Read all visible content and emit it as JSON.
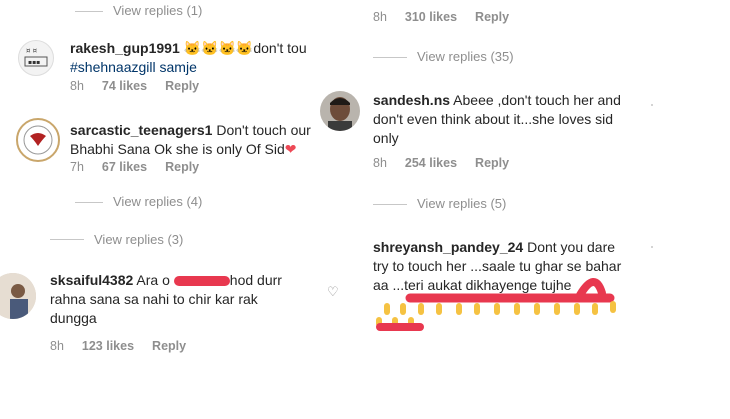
{
  "left_column": {
    "top_view_replies": "View replies (1)",
    "comments": [
      {
        "username": "rakesh_gup1991",
        "text_after_emoji": "don't tou",
        "emoji_icons": [
          "angry-cat-icon",
          "angry-cat-icon",
          "angry-cat-icon",
          "angry-cat-icon"
        ],
        "line2": "#shehnaazgill samje",
        "time": "8h",
        "likes": "74 likes",
        "reply": "Reply"
      },
      {
        "username": "sarcastic_teenagers1",
        "text_line1": "Don't touch our",
        "text_line2": "Bhabhi Sana Ok she is only Of Sid",
        "heart": "❤",
        "time": "7h",
        "likes": "67 likes",
        "reply": "Reply"
      }
    ],
    "view_replies_4": "View replies (4)",
    "view_replies_3": "View replies (3)",
    "comment3": {
      "username": "sksaiful4382",
      "text_line1_a": "Ara o",
      "text_line1_b": "hod durr",
      "text_line2": "rahna sana sa nahi to chir kar rak",
      "text_line3": "dungga",
      "time": "8h",
      "likes": "123 likes",
      "reply": "Reply"
    }
  },
  "right_column": {
    "top_meta": {
      "time": "8h",
      "likes": "310 likes",
      "reply": "Reply"
    },
    "view_replies_35": "View replies (35)",
    "comment1": {
      "username": "sandesh.ns",
      "text_line1": "Abeee ,don't touch her and",
      "text_line2": "don't even think about it...she loves sid",
      "text_line3": "only",
      "time": "8h",
      "likes": "254 likes",
      "reply": "Reply"
    },
    "view_replies_5": "View replies (5)",
    "comment2": {
      "username": "shreyansh_pandey_24",
      "text_line1": "Dont you dare",
      "text_line2": "try to touch her ...saale tu ghar se bahar",
      "text_line3": "aa ...teri aukat dikhayenge tujhe"
    }
  },
  "colors": {
    "text": "#262626",
    "muted": "#8e8e8e",
    "hashtag": "#003569",
    "scribble_red": "#e8384f",
    "scribble_yellow": "#f5c242",
    "heart": "#ed4956"
  }
}
